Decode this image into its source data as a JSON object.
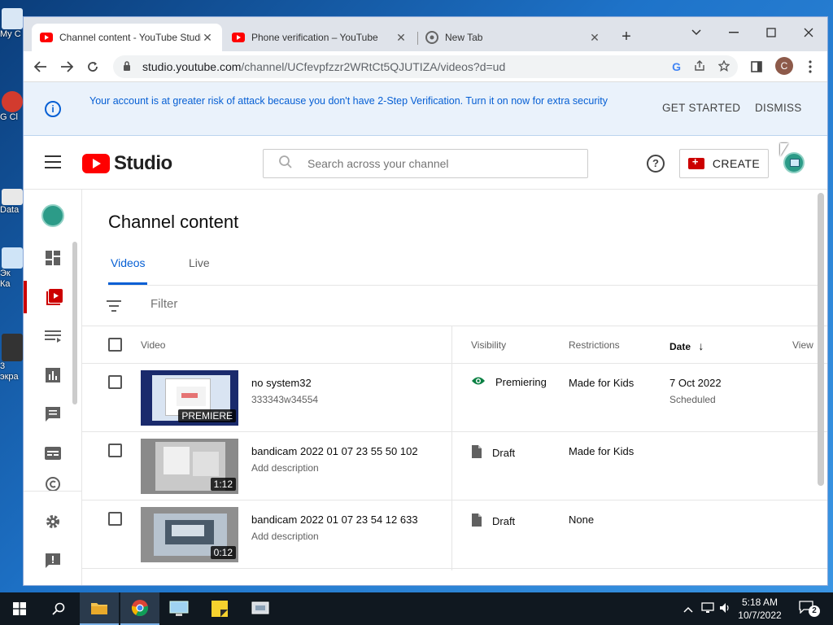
{
  "desktop": {
    "icons": [
      {
        "label": "My C"
      },
      {
        "label": "G Cl"
      },
      {
        "label": "Data"
      },
      {
        "label": "Эк Ка"
      },
      {
        "label": "3 экра"
      }
    ]
  },
  "browser": {
    "tabs": [
      {
        "title": "Channel content - YouTube Studio",
        "icon": "youtube-icon",
        "active": true
      },
      {
        "title": "Phone verification – YouTube",
        "icon": "youtube-icon",
        "active": false
      },
      {
        "title": "New Tab",
        "icon": "chrome-icon",
        "active": false
      }
    ],
    "close_glyph": "✕",
    "new_tab_glyph": "+",
    "url_domain": "studio.youtube.com",
    "url_path": "/channel/UCfevpfzzr2WRtCt5QJUTIZA/videos?d=ud",
    "profile_initial": "C"
  },
  "banner": {
    "message": "Your account is at greater risk of attack because you don't have 2-Step Verification. Turn it on now for extra security",
    "get_started": "GET STARTED",
    "dismiss": "DISMISS",
    "info_glyph": "i"
  },
  "header": {
    "logo_text": "Studio",
    "search_placeholder": "Search across your channel",
    "help_glyph": "?",
    "create_label": "CREATE"
  },
  "content": {
    "title": "Channel content",
    "tabs": [
      {
        "label": "Videos",
        "active": true
      },
      {
        "label": "Live",
        "active": false
      }
    ],
    "filter_placeholder": "Filter",
    "columns": {
      "video": "Video",
      "visibility": "Visibility",
      "restrictions": "Restrictions",
      "date": "Date",
      "date_sort_glyph": "↓",
      "views": "View"
    },
    "rows": [
      {
        "title": "no system32",
        "description": "333343w34554",
        "badge": "PREMIERE",
        "visibility": "Premiering",
        "visibility_icon": "eye-icon",
        "restrictions": "Made for Kids",
        "date": "7 Oct 2022",
        "date_status": "Scheduled"
      },
      {
        "title": "bandicam 2022 01 07 23 55 50 102",
        "description": "Add description",
        "badge": "1:12",
        "visibility": "Draft",
        "visibility_icon": "draft-icon",
        "restrictions": "Made for Kids",
        "date": "",
        "date_status": ""
      },
      {
        "title": "bandicam 2022 01 07 23 54 12 633",
        "description": "Add description",
        "badge": "0:12",
        "visibility": "Draft",
        "visibility_icon": "draft-icon",
        "restrictions": "None",
        "date": "",
        "date_status": ""
      }
    ]
  },
  "taskbar": {
    "time": "5:18 AM",
    "date": "10/7/2022",
    "notifications": "2"
  },
  "colors": {
    "accent_blue": "#065fd4",
    "youtube_red": "#ff0000",
    "premiering_green": "#0b8043"
  }
}
